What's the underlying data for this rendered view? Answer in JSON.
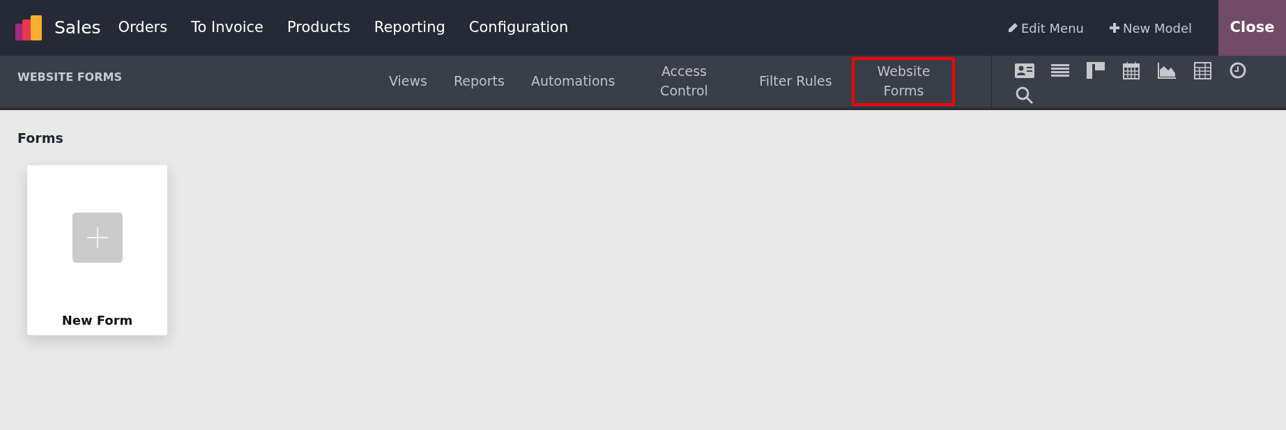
{
  "app": {
    "name": "Sales"
  },
  "menu": [
    "Orders",
    "To Invoice",
    "Products",
    "Reporting",
    "Configuration"
  ],
  "actions": [
    {
      "kind": "edit",
      "label": "Edit Menu"
    },
    {
      "kind": "add",
      "label": "New Model"
    }
  ],
  "close_button": "Close",
  "sub_bar": {
    "title": "WEBSITE FORMS",
    "tabs": [
      {
        "label": "Views",
        "highlighted": false
      },
      {
        "label": "Reports",
        "highlighted": false
      },
      {
        "label": "Automations",
        "highlighted": false
      },
      {
        "label": "Access Control",
        "highlighted": false
      },
      {
        "label": "Filter Rules",
        "highlighted": false
      },
      {
        "label": "Website Forms",
        "highlighted": true
      }
    ],
    "view_icons": [
      {
        "kind": "card"
      },
      {
        "kind": "list"
      },
      {
        "kind": "kanban"
      },
      {
        "kind": "calendar"
      },
      {
        "kind": "graph"
      },
      {
        "kind": "pivot"
      },
      {
        "kind": "clock"
      },
      {
        "kind": "search"
      }
    ]
  },
  "section": {
    "title": "Forms",
    "cards": [
      {
        "label": "New Form"
      }
    ]
  }
}
